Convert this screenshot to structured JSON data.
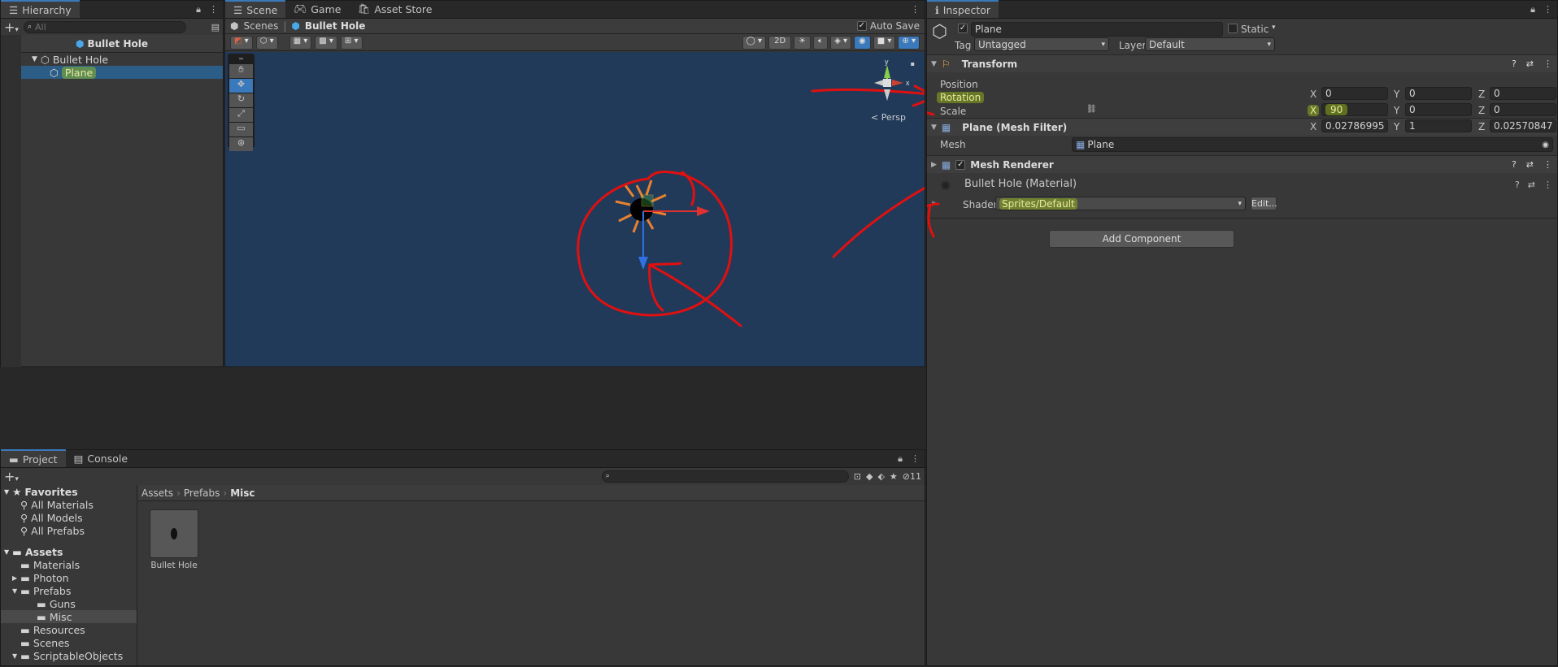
{
  "hierarchy": {
    "tab_label": "Hierarchy",
    "search_placeholder": "All",
    "scene_title": "Bullet Hole",
    "items": [
      {
        "label": "Bullet Hole"
      },
      {
        "label": "Plane"
      }
    ]
  },
  "scene_panel": {
    "tabs": [
      {
        "label": "Scene"
      },
      {
        "label": "Game"
      },
      {
        "label": "Asset Store"
      }
    ],
    "breadcrumb": {
      "root": "Scenes",
      "current": "Bullet Hole"
    },
    "auto_save_label": "Auto Save",
    "toggle_2d_label": "2D",
    "gizmo": {
      "y_label": "y",
      "x_label": "x",
      "view_label": "Persp"
    }
  },
  "inspector": {
    "tab_label": "Inspector",
    "object_name": "Plane",
    "static_label": "Static",
    "tag_label": "Tag",
    "tag_value": "Untagged",
    "layer_label": "Layer",
    "layer_value": "Default",
    "transform": {
      "title": "Transform",
      "position": {
        "label": "Position",
        "x": "0",
        "y": "0",
        "z": "0"
      },
      "rotation": {
        "label": "Rotation",
        "x": "90",
        "y": "0",
        "z": "0"
      },
      "scale": {
        "label": "Scale",
        "x": "0.02786995",
        "y": "1",
        "z": "0.02570847"
      }
    },
    "mesh_filter": {
      "title": "Plane (Mesh Filter)",
      "mesh_label": "Mesh",
      "mesh_value": "Plane"
    },
    "mesh_renderer": {
      "title": "Mesh Renderer"
    },
    "material": {
      "title": "Bullet Hole (Material)",
      "shader_label": "Shader",
      "shader_value": "Sprites/Default",
      "edit_label": "Edit..."
    },
    "add_component_label": "Add Component",
    "axis_labels": {
      "x": "X",
      "y": "Y",
      "z": "Z"
    }
  },
  "project": {
    "tabs": [
      {
        "label": "Project"
      },
      {
        "label": "Console"
      }
    ],
    "hidden_count": "11",
    "favorites_label": "Favorites",
    "favorites": [
      {
        "label": "All Materials"
      },
      {
        "label": "All Models"
      },
      {
        "label": "All Prefabs"
      }
    ],
    "assets_label": "Assets",
    "folders": [
      {
        "label": "Materials"
      },
      {
        "label": "Photon"
      },
      {
        "label": "Prefabs"
      },
      {
        "label": "Guns"
      },
      {
        "label": "Misc"
      },
      {
        "label": "Resources"
      },
      {
        "label": "Scenes"
      },
      {
        "label": "ScriptableObjects"
      }
    ],
    "breadcrumb": [
      "Assets",
      "Prefabs",
      "Misc"
    ],
    "asset_items": [
      {
        "label": "Bullet Hole"
      }
    ]
  },
  "colors": {
    "scene_bg": "#213a5a",
    "selection": "#2c5d87",
    "highlight": "#a0c814",
    "annotation": "#e01010",
    "accent": "#3a79bb"
  }
}
